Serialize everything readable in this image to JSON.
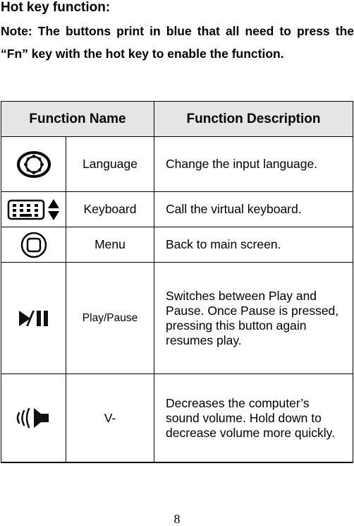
{
  "heading": "Hot key function:",
  "note": "Note: The buttons print in blue that all need to press the “Fn” key with the hot key to enable the function.",
  "table": {
    "headers": [
      "Function Name",
      "Function Description"
    ],
    "rows": [
      {
        "icon": "language-globe-icon",
        "name": "Language",
        "description": "Change the input language."
      },
      {
        "icon": "virtual-keyboard-icon",
        "name": "Keyboard",
        "description": "Call the virtual keyboard."
      },
      {
        "icon": "home-menu-icon",
        "name": "Menu",
        "description": "Back to main screen."
      },
      {
        "icon": "play-pause-icon",
        "name": "Play/Pause",
        "description": "Switches between Play and Pause. Once Pause is pressed, pressing this button again resumes play."
      },
      {
        "icon": "volume-down-icon",
        "name": "V-",
        "description": "Decreases the computer’s sound volume.  Hold down to decrease volume more quickly."
      }
    ]
  },
  "page_number": "8"
}
